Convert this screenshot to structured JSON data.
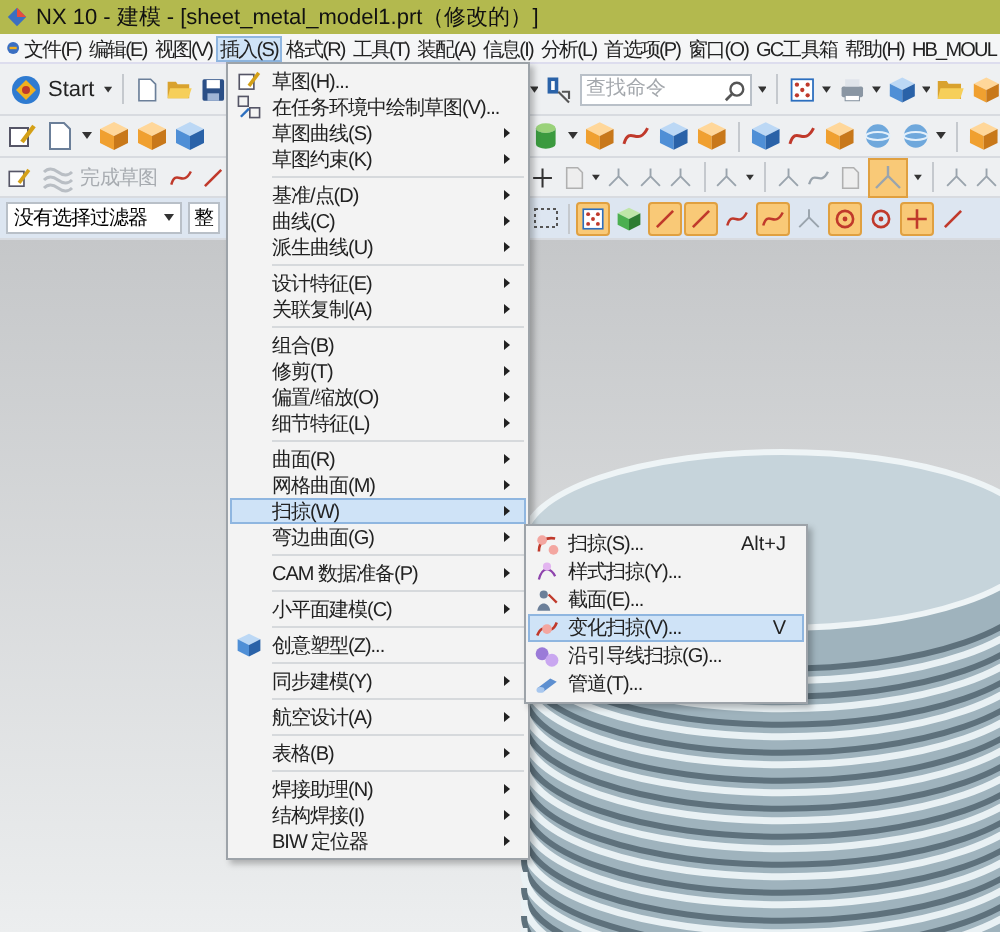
{
  "window": {
    "title": "NX 10 - 建模 - [sheet_metal_model1.prt（修改的）]"
  },
  "menubar": [
    {
      "label": "文件(F)",
      "selected": false
    },
    {
      "label": "编辑(E)",
      "selected": false
    },
    {
      "label": "视图(V)",
      "selected": false
    },
    {
      "label": "插入(S)",
      "selected": true
    },
    {
      "label": "格式(R)",
      "selected": false
    },
    {
      "label": "工具(T)",
      "selected": false
    },
    {
      "label": "装配(A)",
      "selected": false
    },
    {
      "label": "信息(I)",
      "selected": false
    },
    {
      "label": "分析(L)",
      "selected": false
    },
    {
      "label": "首选项(P)",
      "selected": false
    },
    {
      "label": "窗口(O)",
      "selected": false
    },
    {
      "label": "GC工具箱",
      "selected": false
    },
    {
      "label": "帮助(H)",
      "selected": false
    },
    {
      "label": "HB_MOUL",
      "selected": false
    }
  ],
  "toolbar": {
    "start_button": "Start",
    "search": {
      "placeholder": "查找命令"
    },
    "finish_sketch": {
      "label": "完成草图",
      "disabled": true
    }
  },
  "selection_bar": {
    "filter": "没有选择过滤器",
    "scope": "整",
    "snap_points": [
      {
        "on": true
      },
      {
        "on": false
      },
      {
        "on": true
      },
      {
        "on": true
      },
      {
        "on": false
      },
      {
        "on": true
      },
      {
        "on": false
      },
      {
        "on": true
      },
      {
        "on": false
      },
      {
        "on": true
      },
      {
        "on": false
      }
    ]
  },
  "insert_menu": {
    "groups": [
      [
        {
          "label": "草图(H)...",
          "kind": "command",
          "selected": false
        },
        {
          "label": "在任务环境中绘制草图(V)...",
          "kind": "command",
          "selected": false
        },
        {
          "label": "草图曲线(S)",
          "kind": "submenu",
          "selected": false
        },
        {
          "label": "草图约束(K)",
          "kind": "submenu",
          "selected": false
        }
      ],
      [
        {
          "label": "基准/点(D)",
          "kind": "submenu",
          "selected": false
        },
        {
          "label": "曲线(C)",
          "kind": "submenu",
          "selected": false
        },
        {
          "label": "派生曲线(U)",
          "kind": "submenu",
          "selected": false
        }
      ],
      [
        {
          "label": "设计特征(E)",
          "kind": "submenu",
          "selected": false
        },
        {
          "label": "关联复制(A)",
          "kind": "submenu",
          "selected": false
        }
      ],
      [
        {
          "label": "组合(B)",
          "kind": "submenu",
          "selected": false
        },
        {
          "label": "修剪(T)",
          "kind": "submenu",
          "selected": false
        },
        {
          "label": "偏置/缩放(O)",
          "kind": "submenu",
          "selected": false
        },
        {
          "label": "细节特征(L)",
          "kind": "submenu",
          "selected": false
        }
      ],
      [
        {
          "label": "曲面(R)",
          "kind": "submenu",
          "selected": false
        },
        {
          "label": "网格曲面(M)",
          "kind": "submenu",
          "selected": false
        },
        {
          "label": "扫掠(W)",
          "kind": "submenu",
          "selected": true
        },
        {
          "label": "弯边曲面(G)",
          "kind": "submenu",
          "selected": false
        }
      ],
      [
        {
          "label": "CAM 数据准备(P)",
          "kind": "submenu",
          "selected": false
        }
      ],
      [
        {
          "label": "小平面建模(C)",
          "kind": "submenu",
          "selected": false
        }
      ],
      [
        {
          "label": "创意塑型(Z)...",
          "kind": "command",
          "selected": false
        }
      ],
      [
        {
          "label": "同步建模(Y)",
          "kind": "submenu",
          "selected": false
        }
      ],
      [
        {
          "label": "航空设计(A)",
          "kind": "submenu",
          "selected": false
        }
      ],
      [
        {
          "label": "表格(B)",
          "kind": "submenu",
          "selected": false
        }
      ],
      [
        {
          "label": "焊接助理(N)",
          "kind": "submenu",
          "selected": false
        },
        {
          "label": "结构焊接(I)",
          "kind": "submenu",
          "selected": false
        },
        {
          "label": "BIW 定位器",
          "kind": "submenu",
          "selected": false
        }
      ]
    ]
  },
  "sweep_submenu": {
    "items": [
      {
        "label": "扫掠(S)...",
        "shortcut": "Alt+J",
        "selected": false
      },
      {
        "label": "样式扫掠(Y)...",
        "selected": false
      },
      {
        "label": "截面(E)...",
        "selected": false
      },
      {
        "label": "变化扫掠(V)...",
        "shortcut": "V",
        "selected": true
      },
      {
        "label": "沿引导线扫掠(G)...",
        "selected": false
      },
      {
        "label": "管道(T)...",
        "selected": false
      }
    ]
  }
}
